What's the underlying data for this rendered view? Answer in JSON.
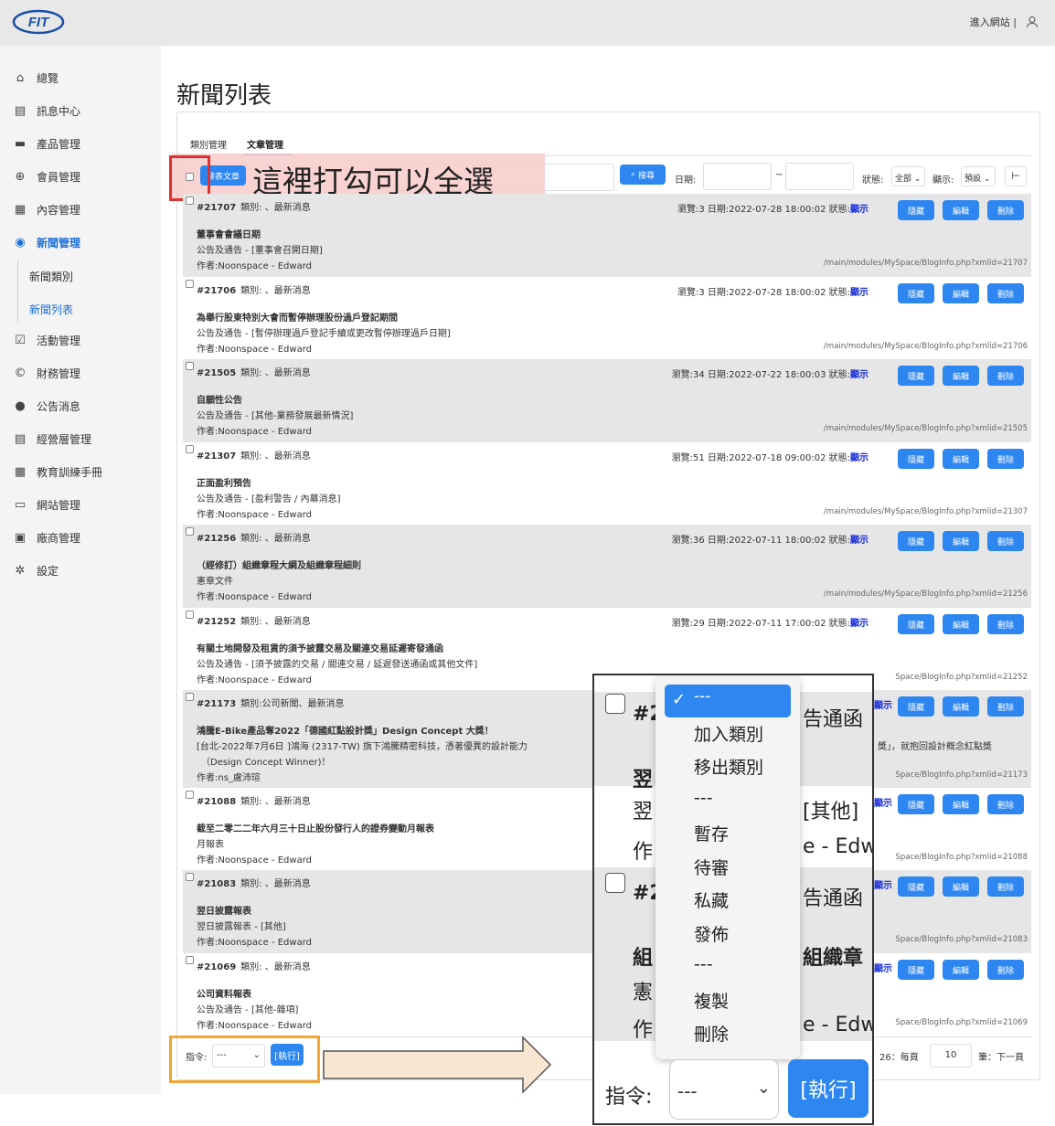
{
  "brand": {
    "logo": "FIT"
  },
  "header": {
    "enter_site": "進入網站 |"
  },
  "page_title": "新聞列表",
  "sidebar": {
    "items": [
      {
        "label": "總覽",
        "icon": "home-icon",
        "glyph": "⌂"
      },
      {
        "label": "訊息中心",
        "icon": "message-icon",
        "glyph": "▤"
      },
      {
        "label": "產品管理",
        "icon": "briefcase-icon",
        "glyph": "▬"
      },
      {
        "label": "會員管理",
        "icon": "member-icon",
        "glyph": "⊕"
      },
      {
        "label": "內容管理",
        "icon": "content-icon",
        "glyph": "▦"
      },
      {
        "label": "新聞管理",
        "icon": "globe-icon",
        "glyph": "◉"
      },
      {
        "label": "活動管理",
        "icon": "check-icon",
        "glyph": "☑"
      },
      {
        "label": "財務管理",
        "icon": "copyright-icon",
        "glyph": "©"
      },
      {
        "label": "公告消息",
        "icon": "info-icon",
        "glyph": "●"
      },
      {
        "label": "經營層管理",
        "icon": "board-icon",
        "glyph": "▤"
      },
      {
        "label": "教育訓練手冊",
        "icon": "manual-icon",
        "glyph": "▦"
      },
      {
        "label": "網站管理",
        "icon": "site-icon",
        "glyph": "▭"
      },
      {
        "label": "廠商管理",
        "icon": "vendor-icon",
        "glyph": "▣"
      },
      {
        "label": "設定",
        "icon": "gear-icon",
        "glyph": "✲"
      }
    ],
    "sub": [
      "新聞類別",
      "新聞列表"
    ]
  },
  "tabs": [
    "類別管理",
    "文章管理"
  ],
  "toolbar": {
    "new": "發表文章",
    "search": "搜尋",
    "date": "日期:",
    "tilde": "~",
    "status": "狀態:",
    "status_val": "全部",
    "display": "顯示:",
    "display_val": "預設"
  },
  "annotation": "這裡打勾可以全選",
  "rows": [
    {
      "id": "#21707",
      "cat": "類別: 、最新消息",
      "meta": "瀏覽:3 日期:2022-07-28 18:00:02 狀態:",
      "title": "董事會會議日期",
      "sub": "公告及通告 - [董事會召開日期]",
      "author": "作者:Noonspace - Edward",
      "path": "/main/modules/MySpace/BlogInfo.php?xmlid=21707"
    },
    {
      "id": "#21706",
      "cat": "類別: 、最新消息",
      "meta": "瀏覽:3 日期:2022-07-28 18:00:02 狀態:",
      "title": "為舉行股東特別大會而暫停辦理股份過戶登記期間",
      "sub": "公告及通告 - [暫停辦理過戶登記手續或更改暫停辦理過戶日期]",
      "author": "作者:Noonspace - Edward",
      "path": "/main/modules/MySpace/BlogInfo.php?xmlid=21706"
    },
    {
      "id": "#21505",
      "cat": "類別: 、最新消息",
      "meta": "瀏覽:34 日期:2022-07-22 18:00:03 狀態:",
      "title": "自願性公告",
      "sub": "公告及通告 - [其他-業務發展最新情況]",
      "author": "作者:Noonspace - Edward",
      "path": "/main/modules/MySpace/BlogInfo.php?xmlid=21505"
    },
    {
      "id": "#21307",
      "cat": "類別: 、最新消息",
      "meta": "瀏覽:51 日期:2022-07-18 09:00:02 狀態:",
      "title": "正面盈利預告",
      "sub": "公告及通告 - [盈利警告 / 內幕消息]",
      "author": "作者:Noonspace - Edward",
      "path": "/main/modules/MySpace/BlogInfo.php?xmlid=21307"
    },
    {
      "id": "#21256",
      "cat": "類別: 、最新消息",
      "meta": "瀏覽:36 日期:2022-07-11 18:00:02 狀態:",
      "title": "（經修訂）組織章程大綱及組織章程細則",
      "sub": "憲章文件",
      "author": "作者:Noonspace - Edward",
      "path": "/main/modules/MySpace/BlogInfo.php?xmlid=21256"
    },
    {
      "id": "#21252",
      "cat": "類別: 、最新消息",
      "meta": "瀏覽:29 日期:2022-07-11 17:00:02 狀態:",
      "title": "有關土地開發及租賃的須予披露交易及關連交易延遲寄發通函",
      "sub": "公告及通告 - [須予披露的交易 / 關連交易 / 延遲發送通函或其他文件]",
      "author": "作者:Noonspace - Edward",
      "path": "Space/BlogInfo.php?xmlid=21252"
    },
    {
      "id": "#21173",
      "cat": "類別:公司新聞、最新消息",
      "meta": "",
      "title": "鴻騰E-Bike產品奪2022「德國紅點設計獎」Design Concept 大獎！",
      "sub": "[台北-2022年7月6日 ]鴻海 (2317-TW) 旗下鴻騰精密科技，憑著優異的設計能力",
      "sub2": "（Design Concept Winner)！",
      "sub_right": "獎」，就抱回設計概念紅點獎",
      "author": "作者:ns_盧沛瑄",
      "path": "Space/BlogInfo.php?xmlid=21173"
    },
    {
      "id": "#21088",
      "cat": "類別: 、最新消息",
      "meta": "",
      "title": "截至二零二二年六月三十日止股份發行人的證券變動月報表",
      "sub": "月報表",
      "author": "作者:Noonspace - Edward",
      "path": "Space/BlogInfo.php?xmlid=21088"
    },
    {
      "id": "#21083",
      "cat": "類別: 、最新消息",
      "meta": "",
      "title": "翌日披露報表",
      "sub": "翌日披露報表 - [其他]",
      "author": "作者:Noonspace - Edward",
      "path": "Space/BlogInfo.php?xmlid=21083"
    },
    {
      "id": "#21069",
      "cat": "類別: 、最新消息",
      "meta": "",
      "title": "公司資料報表",
      "sub": "公告及通告 - [其他-雜項]",
      "author": "作者:Noonspace - Edward",
      "path": "Space/BlogInfo.php?xmlid=21069"
    }
  ],
  "status_show": "顯示",
  "actions": {
    "hide": "隱藏",
    "edit": "編輯",
    "delete": "刪除"
  },
  "footer": {
    "cmd": "指令:",
    "cmd_val": "---",
    "exec": "[執行]",
    "pager_left": "26：每頁",
    "per_page": "10",
    "pager_right": "筆：下一頁"
  },
  "zoom": {
    "options": [
      "---",
      "加入類別",
      "移出類別",
      "---",
      "暫存",
      "待審",
      "私藏",
      "發佈",
      "---",
      "複製",
      "刪除"
    ],
    "left_texts": [
      "#2",
      "翌",
      "翌",
      "作",
      "#2",
      "組",
      "憲",
      "作"
    ],
    "right_texts": [
      "告通函",
      "[其他]",
      "e - Edw",
      "告通函",
      "組織章",
      "e - Edw"
    ],
    "cmd": "指令:",
    "cmd_val": "---",
    "exec": "[執行]"
  },
  "colors": {
    "accent": "#2e86f0",
    "annot_red": "#e03030",
    "annot_orange": "#f5a531"
  }
}
